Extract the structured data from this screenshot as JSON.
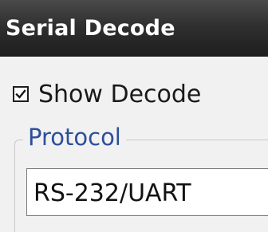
{
  "window": {
    "title": "Serial Decode"
  },
  "show_decode": {
    "label": "Show Decode",
    "checked": true
  },
  "protocol_group": {
    "legend": "Protocol",
    "selected_value": "RS-232/UART"
  },
  "colors": {
    "title_bar": "#2b2b2b",
    "legend_text": "#2d4f9b",
    "panel_background": "#f1f1f1"
  },
  "icons": {
    "checkbox": "check-mark-icon"
  }
}
